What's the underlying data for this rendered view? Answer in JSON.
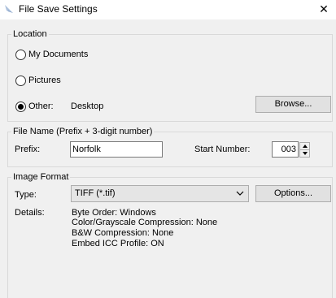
{
  "window": {
    "title": "File Save Settings",
    "icon": "scanner-app-icon",
    "close_glyph": "✕"
  },
  "location": {
    "group_label": "Location",
    "options": [
      {
        "label": "My Documents",
        "selected": false
      },
      {
        "label": "Pictures",
        "selected": false
      },
      {
        "label": "Other:",
        "selected": true
      }
    ],
    "other_path": "Desktop",
    "browse_label": "Browse..."
  },
  "file_name": {
    "group_label": "File Name (Prefix + 3-digit number)",
    "prefix_label": "Prefix:",
    "prefix_value": "Norfolk",
    "start_number_label": "Start Number:",
    "start_number_value": "003"
  },
  "image_format": {
    "group_label": "Image Format",
    "type_label": "Type:",
    "type_value": "TIFF (*.tif)",
    "options_label": "Options...",
    "details_label": "Details:",
    "details": [
      "Byte Order: Windows",
      "Color/Grayscale Compression: None",
      "B&W Compression: None",
      "Embed ICC Profile: ON"
    ]
  }
}
